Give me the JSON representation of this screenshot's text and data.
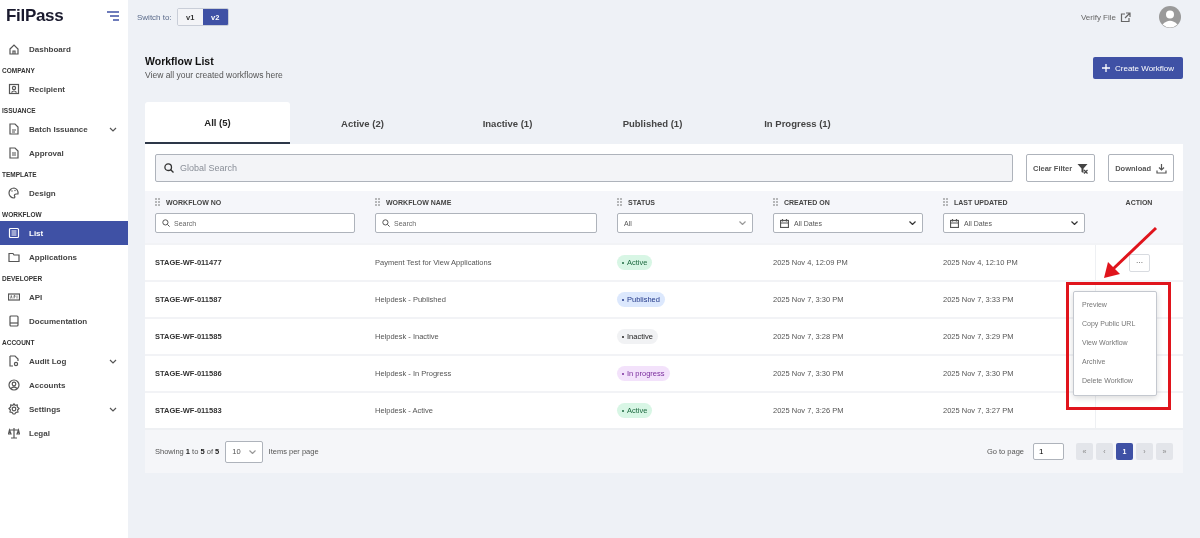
{
  "sidebar": {
    "logo": "FilPass",
    "sections": [
      {
        "items": [
          {
            "label": "Dashboard",
            "selected": false
          }
        ]
      },
      {
        "title": "COMPANY",
        "items": [
          {
            "label": "Recipient",
            "selected": false
          }
        ]
      },
      {
        "title": "ISSUANCE",
        "items": [
          {
            "label": "Batch Issuance",
            "selected": false,
            "has_submenu": true
          },
          {
            "label": "Approval",
            "selected": false
          }
        ]
      },
      {
        "title": "TEMPLATE",
        "items": [
          {
            "label": "Design",
            "selected": false
          }
        ]
      },
      {
        "title": "WORKFLOW",
        "items": [
          {
            "label": "List",
            "selected": true
          },
          {
            "label": "Applications",
            "selected": false
          }
        ]
      },
      {
        "title": "DEVELOPER",
        "items": [
          {
            "label": "API",
            "selected": false
          },
          {
            "label": "Documentation",
            "selected": false
          }
        ]
      },
      {
        "title": "ACCOUNT",
        "items": [
          {
            "label": "Audit Log",
            "selected": false,
            "has_submenu": true
          },
          {
            "label": "Accounts",
            "selected": false
          },
          {
            "label": "Settings",
            "selected": false,
            "has_submenu": true
          },
          {
            "label": "Legal",
            "selected": false
          }
        ]
      }
    ]
  },
  "topbar": {
    "switch_label": "Switch to:",
    "versions": [
      {
        "label": "v1",
        "selected": false
      },
      {
        "label": "v2",
        "selected": true
      }
    ],
    "verify_link": "Verify File"
  },
  "header": {
    "title": "Workflow List",
    "subtitle": "View all your created workflows here",
    "create_button": "Create Workflow"
  },
  "tabs": [
    {
      "label": "All (5)",
      "selected": true
    },
    {
      "label": "Active (2)",
      "selected": false
    },
    {
      "label": "Inactive (1)",
      "selected": false
    },
    {
      "label": "Published (1)",
      "selected": false
    },
    {
      "label": "In Progress (1)",
      "selected": false
    }
  ],
  "toolbar": {
    "search_placeholder": "Global Search",
    "clear_button": "Clear Filter",
    "download_button": "Download"
  },
  "table": {
    "columns": [
      {
        "label": "WORKFLOW NO",
        "filter": {
          "kind": "search",
          "placeholder": "Search"
        }
      },
      {
        "label": "WORKFLOW NAME",
        "filter": {
          "kind": "search",
          "placeholder": "Search"
        }
      },
      {
        "label": "STATUS",
        "filter": {
          "kind": "select",
          "value": "All"
        }
      },
      {
        "label": "CREATED ON",
        "filter": {
          "kind": "date",
          "value": "All Dates"
        }
      },
      {
        "label": "LAST UPDATED",
        "filter": {
          "kind": "date",
          "value": "All Dates"
        }
      },
      {
        "label": "ACTION"
      }
    ],
    "rows": [
      {
        "no": "STAGE-WF-011477",
        "name": "Payment Test for View Applications",
        "status": {
          "label": "Active",
          "kind": "active"
        },
        "created": "2025 Nov 4, 12:09 PM",
        "updated": "2025 Nov 4, 12:10 PM",
        "action": "···"
      },
      {
        "no": "STAGE-WF-011587",
        "name": "Helpdesk - Published",
        "status": {
          "label": "Published",
          "kind": "published"
        },
        "created": "2025 Nov 7, 3:30 PM",
        "updated": "2025 Nov 7, 3:33 PM"
      },
      {
        "no": "STAGE-WF-011585",
        "name": "Helpdesk - Inactive",
        "status": {
          "label": "Inactive",
          "kind": "inactive"
        },
        "created": "2025 Nov 7, 3:28 PM",
        "updated": "2025 Nov 7, 3:29 PM"
      },
      {
        "no": "STAGE-WF-011586",
        "name": "Helpdesk - In Progress",
        "status": {
          "label": "In progress",
          "kind": "progress"
        },
        "created": "2025 Nov 7, 3:30 PM",
        "updated": "2025 Nov 7, 3:30 PM"
      },
      {
        "no": "STAGE-WF-011583",
        "name": "Helpdesk - Active",
        "status": {
          "label": "Active",
          "kind": "active"
        },
        "created": "2025 Nov 7, 3:26 PM",
        "updated": "2025 Nov 7, 3:27 PM"
      }
    ]
  },
  "action_menu": {
    "items": [
      "Preview",
      "Copy Public URL",
      "View Workflow",
      "Archive",
      "Delete Workflow"
    ]
  },
  "footer": {
    "showing": "Showing **1** to **5** of **5**",
    "page_size": "10",
    "per_page_label": "Items per page",
    "goto_label": "Go to page",
    "goto_value": "1",
    "pager": [
      {
        "label": "«",
        "selected": false
      },
      {
        "label": "‹",
        "selected": false
      },
      {
        "label": "1",
        "selected": true
      },
      {
        "label": "›",
        "selected": false
      },
      {
        "label": "»",
        "selected": false
      }
    ]
  },
  "highlight": {
    "arrow": true,
    "frame": true
  }
}
